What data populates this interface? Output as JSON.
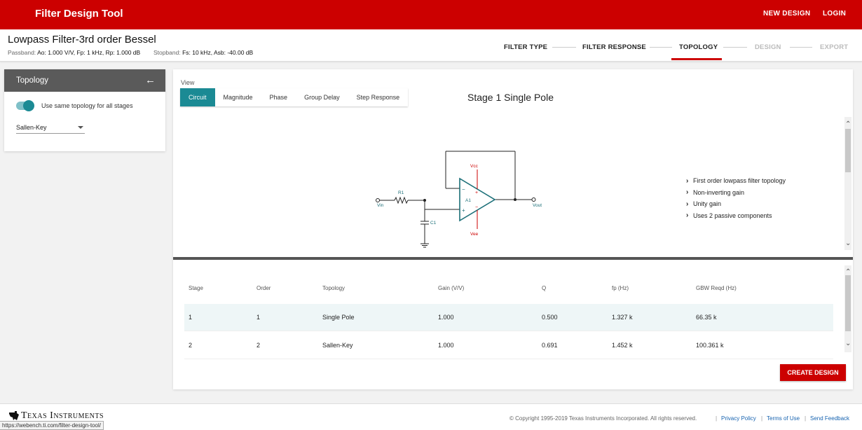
{
  "header": {
    "app_title": "Filter Design Tool",
    "new_design": "NEW DESIGN",
    "login": "LOGIN"
  },
  "design": {
    "title": "Lowpass Filter-3rd order Bessel",
    "passband_label": "Passband:",
    "passband_value": "Ao: 1.000 V/V, Fp: 1 kHz, Rp: 1.000 dB",
    "stopband_label": "Stopband:",
    "stopband_value": "Fs: 10 kHz, Asb: -40.00 dB"
  },
  "steps": [
    {
      "label": "FILTER TYPE",
      "state": "done"
    },
    {
      "label": "FILTER RESPONSE",
      "state": "done"
    },
    {
      "label": "TOPOLOGY",
      "state": "active"
    },
    {
      "label": "DESIGN",
      "state": "pending"
    },
    {
      "label": "EXPORT",
      "state": "pending"
    }
  ],
  "sidebar": {
    "title": "Topology",
    "toggle_label": "Use same topology for all stages",
    "toggle_on": true,
    "topology_select": "Sallen-Key"
  },
  "view": {
    "label": "View",
    "tabs": [
      "Circuit",
      "Magnitude",
      "Phase",
      "Group Delay",
      "Step Response"
    ],
    "active_tab": "Circuit",
    "stage_title": "Stage 1 Single Pole"
  },
  "circuit": {
    "vin": "Vin",
    "vout": "Vout",
    "r1": "R1",
    "c1": "C1",
    "a1": "A1",
    "vcc": "Vcc",
    "vee": "Vee",
    "minus": "−",
    "plus": "+",
    "wire_color": "#222222",
    "opamp_color": "#1b6f78",
    "supply_color": "#cc0000"
  },
  "features": [
    "First order lowpass filter topology",
    "Non-inverting gain",
    "Unity gain",
    "Uses 2 passive components"
  ],
  "table": {
    "columns": [
      "Stage",
      "Order",
      "Topology",
      "Gain (V/V)",
      "Q",
      "fp (Hz)",
      "GBW Reqd (Hz)"
    ],
    "rows": [
      [
        "1",
        "1",
        "Single Pole",
        "1.000",
        "0.500",
        "1.327 k",
        "66.35 k"
      ],
      [
        "2",
        "2",
        "Sallen-Key",
        "1.000",
        "0.691",
        "1.452 k",
        "100.361 k"
      ]
    ],
    "selected_row": 0
  },
  "actions": {
    "create_design": "CREATE DESIGN"
  },
  "footer": {
    "logo_text": "Texas Instruments",
    "copyright": "© Copyright 1995-2019  Texas Instruments Incorporated.  All rights reserved.",
    "privacy": "Privacy Policy",
    "terms": "Terms of Use",
    "feedback": "Send Feedback",
    "separator": "|"
  },
  "status_url": "https://webench.ti.com/filter-design-tool/"
}
